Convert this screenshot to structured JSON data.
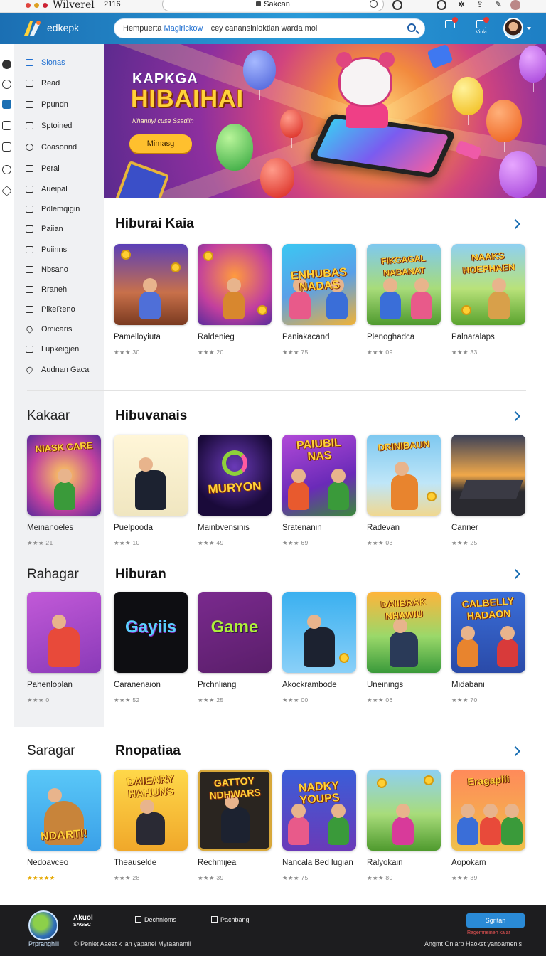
{
  "os": {
    "title": "Wilverel",
    "number": "2116",
    "url": "Sakcan"
  },
  "colors": {
    "brand_blue": "#1b6fb3",
    "accent_yellow": "#ffc02e",
    "link_blue": "#1f6fd0"
  },
  "header": {
    "brand": "edkepk",
    "search_placeholder_a": "Hempuerta",
    "search_placeholder_b": "Magirickow",
    "search_placeholder_c": "cey canansinloktian   warda mol",
    "icons": [
      "inbox-icon",
      "notification-icon"
    ],
    "icon_labels": [
      "",
      "Vinla"
    ]
  },
  "sidebar": {
    "items": [
      {
        "label": "Sionas",
        "icon": "grid-icon"
      },
      {
        "label": "Read",
        "icon": "page-icon"
      },
      {
        "label": "Ppundn",
        "icon": "page-icon"
      },
      {
        "label": "Sptoined",
        "icon": "lock-icon"
      },
      {
        "label": "Coasonnd",
        "icon": "link-icon"
      },
      {
        "label": "Peral",
        "icon": "pen-icon"
      },
      {
        "label": "Aueipal",
        "icon": "box-icon"
      },
      {
        "label": "Pdlemqigin",
        "icon": "page-icon"
      },
      {
        "label": "Paiian",
        "icon": "box-icon"
      },
      {
        "label": "Puiinns",
        "icon": "image-icon"
      },
      {
        "label": "Nbsano",
        "icon": "page-icon"
      },
      {
        "label": "Rraneh",
        "icon": "page-icon"
      },
      {
        "label": "PlkeReno",
        "icon": "camera-icon"
      },
      {
        "label": "Omicaris",
        "icon": "heart-icon"
      },
      {
        "label": "Lupkeigjen",
        "icon": "page-icon"
      },
      {
        "label": "Audnan Gaca",
        "icon": "pin-icon"
      }
    ]
  },
  "hero": {
    "subtitle": "KAPKGA",
    "title": "HIBAIHAI",
    "tagline": "Nhanriyi cuse Ssadlin",
    "button": "Mimasg"
  },
  "sections": [
    {
      "title": "Hiburai Kaia",
      "side_title": "",
      "cards": [
        {
          "name": "Pamelloyiuta",
          "rating": "★★★ 30",
          "art": ""
        },
        {
          "name": "Raldenieg",
          "rating": "★★★ 20",
          "art": ""
        },
        {
          "name": "Paniakacand",
          "rating": "★★★ 75",
          "art": "ENHUBAS NADAS"
        },
        {
          "name": "Plenoghadca",
          "rating": "★★★ 09",
          "art": "FIKGAGAL NABANAT"
        },
        {
          "name": "Palnaralaps",
          "rating": "★★★ 33",
          "art": "NAAKS HOEPHAEN"
        }
      ]
    },
    {
      "title": "Hibuvanais",
      "side_title": "Kakaar",
      "cards": [
        {
          "name": "Meinanoeles",
          "rating": "★★★ 21",
          "art": "NIASK CARE"
        },
        {
          "name": "Puelpooda",
          "rating": "★★★ 10",
          "art": ""
        },
        {
          "name": "Mainbvensinis",
          "rating": "★★★ 49",
          "art": "MURYON"
        },
        {
          "name": "Sratenanin",
          "rating": "★★★ 69",
          "art": "PAIUBIL NAS"
        },
        {
          "name": "Radevan",
          "rating": "★★★ 03",
          "art": "DRINIBAUN"
        },
        {
          "name": "Canner",
          "rating": "★★★ 25",
          "art": ""
        }
      ]
    },
    {
      "title": "Hiburan",
      "side_title": "Rahagar",
      "cards": [
        {
          "name": "Pahenloplan",
          "rating": "★★★ 0",
          "art": ""
        },
        {
          "name": "Caranenaion",
          "rating": "★★★ 52",
          "art": "Gayiis"
        },
        {
          "name": "Prchnliang",
          "rating": "★★★ 25",
          "art": "Game"
        },
        {
          "name": "Akockrambode",
          "rating": "★★★ 00",
          "art": ""
        },
        {
          "name": "Uneinings",
          "rating": "★★★ 06",
          "art": "DAIIBRAK NHAWIU"
        },
        {
          "name": "Midabani",
          "rating": "★★★ 70",
          "art": "CALBELLY HADAON"
        }
      ]
    },
    {
      "title": "Rnopatiaa",
      "side_title": "Saragar",
      "cards": [
        {
          "name": "Nedoavceo",
          "rating": "★★★★★",
          "art": "NDARTI!"
        },
        {
          "name": "Theauselde",
          "rating": "★★★ 28",
          "art": "DAIEARY HAHUNS"
        },
        {
          "name": "Rechmijea",
          "rating": "★★★ 39",
          "art": "GATTOY NDHWARS"
        },
        {
          "name": "Nancala Bed lugian",
          "rating": "★★★ 75",
          "art": "NADKY YOUPS"
        },
        {
          "name": "Ralyokain",
          "rating": "★★★ 80",
          "art": ""
        },
        {
          "name": "Aopokam",
          "rating": "★★★ 39",
          "art": "Eragapili"
        }
      ]
    }
  ],
  "footer": {
    "logo_text": "Prpranghili",
    "brand_line1": "Akuol",
    "brand_line2": "SAGEC",
    "links": [
      "Dechnioms",
      "Pachbang"
    ],
    "copyright": "© Penlet Aaeat k lan yapanel Myraanamil",
    "button": "Sgritan",
    "note": "Ragemneineh kaiar",
    "right_text": "Angmt Onlarp Haokst yanoamenis"
  }
}
